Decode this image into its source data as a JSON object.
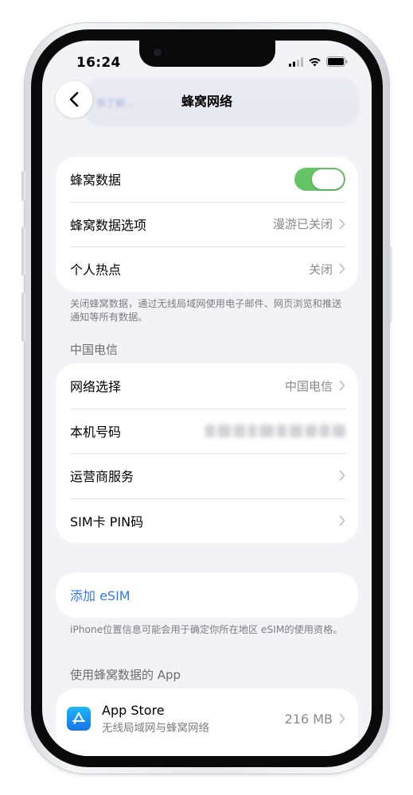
{
  "status_bar": {
    "time": "16:24"
  },
  "nav": {
    "title": "蜂窝网络",
    "back_icon": "chevron-left-icon",
    "ghost_text": "参了解..."
  },
  "cellular_group": {
    "rows": [
      {
        "label": "蜂窝数据",
        "toggle_on": true
      },
      {
        "label": "蜂窝数据选项",
        "value": "漫游已关闭"
      },
      {
        "label": "个人热点",
        "value": "关闭"
      }
    ],
    "footnote": "关闭蜂窝数据，通过无线局域网使用电子邮件、网页浏览和推送通知等所有数据。"
  },
  "carrier_section": {
    "header": "中国电信",
    "rows": [
      {
        "label": "网络选择",
        "value": "中国电信"
      },
      {
        "label": "本机号码",
        "value": ""
      },
      {
        "label": "运营商服务"
      },
      {
        "label": "SIM卡 PIN码"
      }
    ]
  },
  "esim": {
    "label": "添加 eSIM",
    "footnote": "iPhone位置信息可能会用于确定你所在地区 eSIM的使用资格。"
  },
  "apps_section": {
    "header": "使用蜂窝数据的 App",
    "items": [
      {
        "name": "App Store",
        "subtitle": "无线局域网与蜂窝网络",
        "usage": "216 MB",
        "icon": "app-store-icon"
      }
    ]
  },
  "colors": {
    "toggle_on": "#65c466",
    "link_blue": "#3478f6",
    "background": "#f2f2f7"
  }
}
